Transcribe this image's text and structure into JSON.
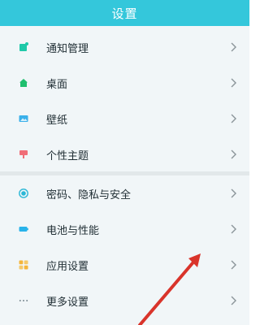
{
  "header": {
    "title": "设置"
  },
  "colors": {
    "header_bg": "#34c7db",
    "page_bg": "#f1f6f8",
    "annotation_arrow": "#d9342b"
  },
  "groups": [
    {
      "items": [
        {
          "label": "通知管理",
          "icon": "notification-icon",
          "color": "#1fc9a9"
        },
        {
          "label": "桌面",
          "icon": "home-icon",
          "color": "#1fbf6e"
        },
        {
          "label": "壁纸",
          "icon": "wallpaper-icon",
          "color": "#3ab0ea"
        },
        {
          "label": "个性主题",
          "icon": "theme-icon",
          "color": "#f06e78"
        }
      ]
    },
    {
      "items": [
        {
          "label": "密码、隐私与安全",
          "icon": "privacy-icon",
          "color": "#2bb7d6"
        },
        {
          "label": "电池与性能",
          "icon": "battery-icon",
          "color": "#29b3ea"
        },
        {
          "label": "应用设置",
          "icon": "apps-icon",
          "color": "#f5b53a"
        },
        {
          "label": "更多设置",
          "icon": "more-icon",
          "color": "#7a8a92"
        }
      ]
    }
  ]
}
